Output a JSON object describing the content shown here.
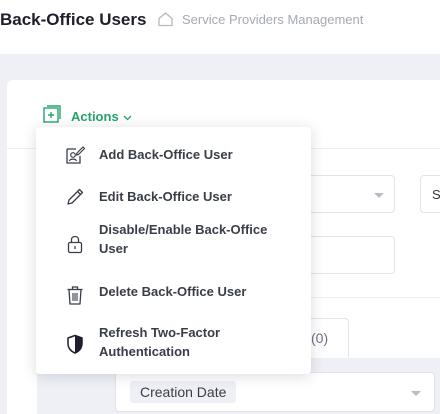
{
  "header": {
    "page_title": "Back-Office Users",
    "breadcrumb_label": "Service Providers Management"
  },
  "actions": {
    "label": "Actions",
    "icon": "add-square-icon"
  },
  "menu": {
    "items": [
      {
        "label": "Add Back-Office User",
        "icon": "add-user-icon"
      },
      {
        "label": "Edit Back-Office User",
        "icon": "pencil-icon"
      },
      {
        "label": "Disable/Enable Back-Office User",
        "icon": "lock-icon"
      },
      {
        "label": "Delete Back-Office User",
        "icon": "trash-icon"
      },
      {
        "label": "Refresh Two-Factor Authentication",
        "icon": "shield-icon"
      }
    ]
  },
  "background": {
    "partial_select_text": "S",
    "partial_tab_text": "(0)",
    "sort_chip": "Creation Date"
  },
  "colors": {
    "accent_green": "#25a56a",
    "page_background": "#eef0f5"
  }
}
